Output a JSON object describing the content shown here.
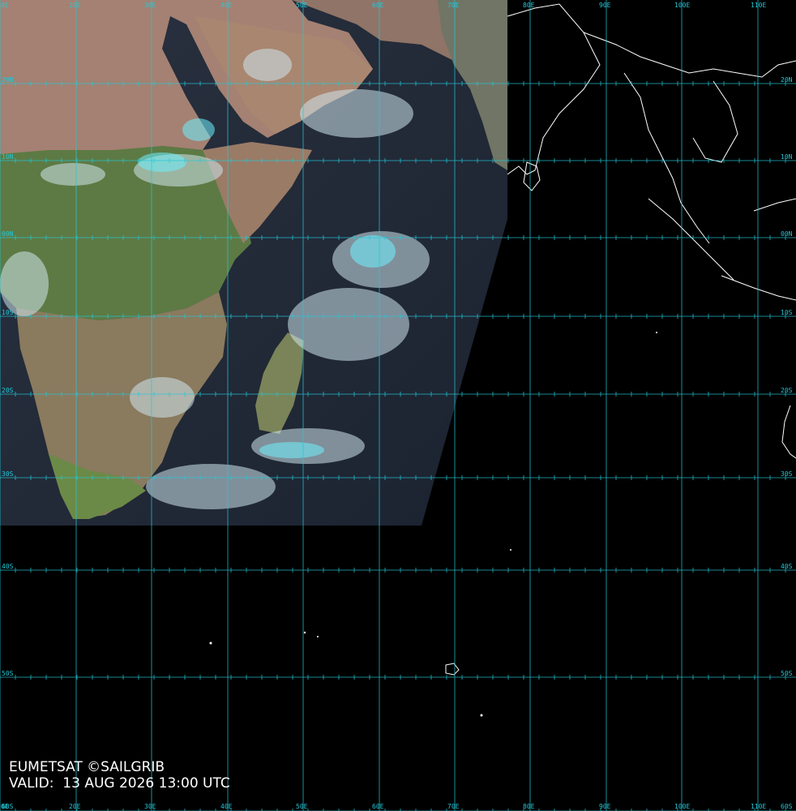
{
  "credit": "EUMETSAT ©SAILGRIB",
  "valid_label": "VALID:",
  "valid_time": "13 AUG 2026 13:00 UTC",
  "grid_color": "#23c8d8",
  "coastline_color": "#ffffff",
  "longitude_labels": [
    "0E",
    "20E",
    "30E",
    "40E",
    "50E",
    "60E",
    "70E",
    "80E",
    "90E",
    "100E",
    "110E"
  ],
  "latitude_labels": [
    "20N",
    "10N",
    "00N",
    "10S",
    "20S",
    "30S",
    "40S",
    "50S",
    "60S"
  ],
  "satellite_coverage": "Africa, Arabia, western Indian Ocean",
  "islands_shown": [
    "Kerguelen"
  ]
}
